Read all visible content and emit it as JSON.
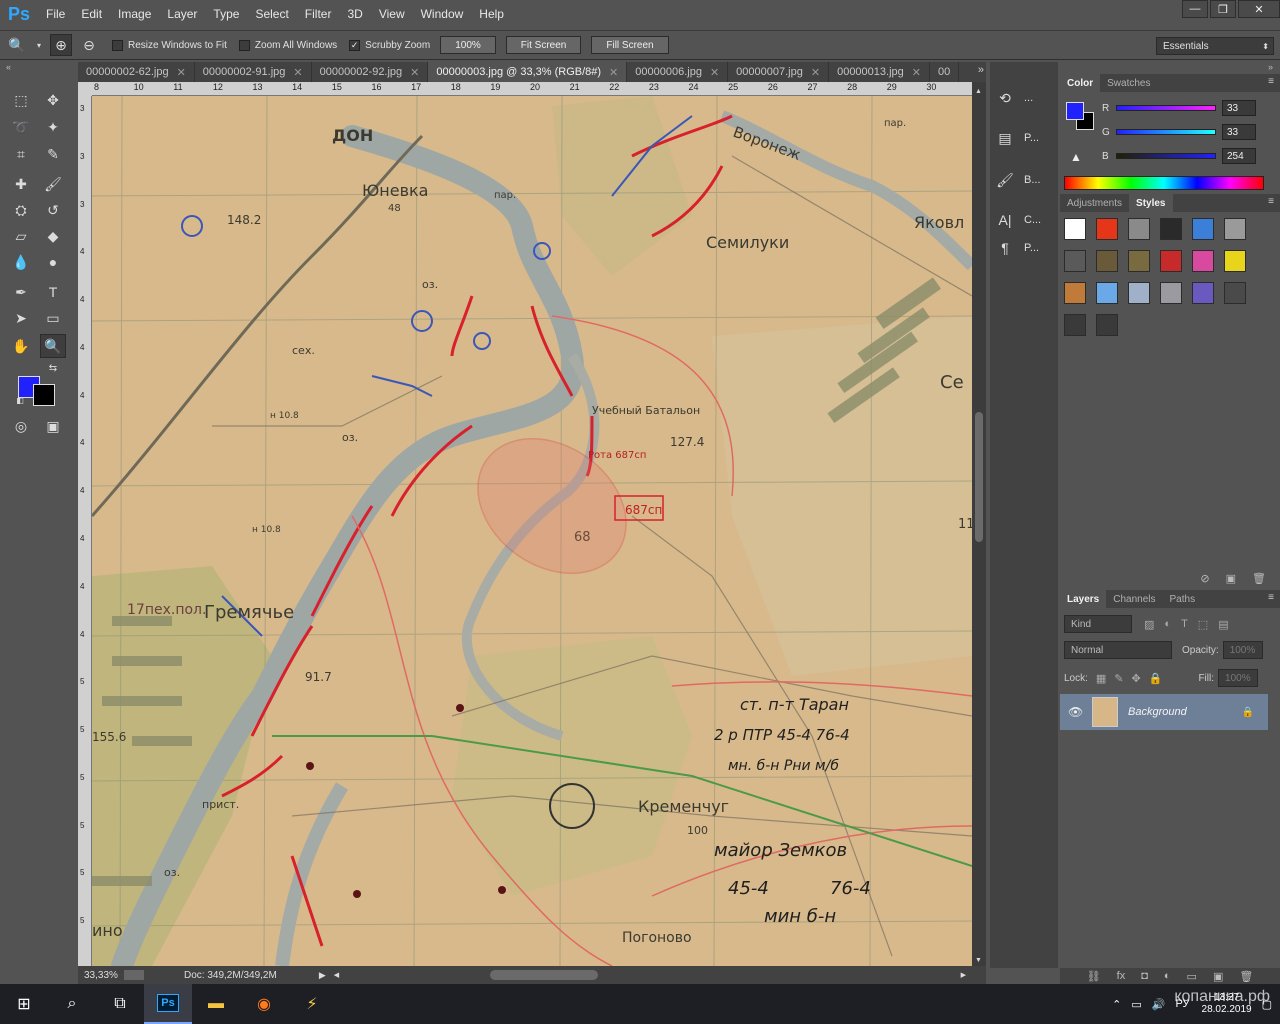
{
  "app": {
    "logo": "Ps",
    "menu": [
      "File",
      "Edit",
      "Image",
      "Layer",
      "Type",
      "Select",
      "Filter",
      "3D",
      "View",
      "Window",
      "Help"
    ],
    "window_controls": [
      "—",
      "❐",
      "✕"
    ]
  },
  "options": {
    "resize_windows": "Resize Windows to Fit",
    "zoom_all": "Zoom All Windows",
    "scrubby": "Scrubby Zoom",
    "pct": "100%",
    "fit": "Fit Screen",
    "fill": "Fill Screen",
    "workspace": "Essentials"
  },
  "tabs": [
    {
      "label": "00000002-62.jpg",
      "active": false
    },
    {
      "label": "00000002-91.jpg",
      "active": false
    },
    {
      "label": "00000002-92.jpg",
      "active": false
    },
    {
      "label": "00000003.jpg @ 33,3% (RGB/8#)",
      "active": true
    },
    {
      "label": "00000006.jpg",
      "active": false
    },
    {
      "label": "00000007.jpg",
      "active": false
    },
    {
      "label": "00000013.jpg",
      "active": false
    },
    {
      "label": "00",
      "active": false
    }
  ],
  "ruler_h": [
    "8",
    "10",
    "11",
    "12",
    "13",
    "14",
    "15",
    "16",
    "17",
    "18",
    "19",
    "20",
    "21",
    "22",
    "23",
    "24",
    "25",
    "26",
    "27",
    "28",
    "29",
    "30"
  ],
  "ruler_v": [
    "3",
    "3",
    "3",
    "4",
    "4",
    "4",
    "4",
    "4",
    "4",
    "4",
    "4",
    "4",
    "5",
    "5",
    "5",
    "5",
    "5",
    "5"
  ],
  "map": {
    "labels": [
      "ДОН",
      "Юневка",
      "48",
      "пар.",
      "Воронеж",
      "Семилуки",
      "Яковл",
      "148.2",
      "оз.",
      "сех.",
      "оз.",
      "Учебный Батальон",
      "127.4",
      "Рота 687сп",
      "687сп",
      "68",
      "Се",
      "17пех.пол.",
      "Гремячье",
      "91.7",
      "155.6",
      "ст. п-т Таран",
      "2 р ПТР 45-4 76-4",
      "мн. б-н Рни м/б",
      "Кременчуг",
      "100",
      "майор Земков",
      "45-4",
      "76-4",
      "мин б-н",
      "Погоново",
      "ино",
      "пар.",
      "прист.",
      "оз.",
      "н 10.8",
      "н 10.8",
      "11"
    ]
  },
  "status": {
    "zoom": "33,33%",
    "doc": "Doc: 349,2M/349,2M"
  },
  "dock": [
    "...",
    "P...",
    "B...",
    "C...",
    "P..."
  ],
  "color_panel": {
    "tabs": [
      "Color",
      "Swatches"
    ],
    "r_label": "R",
    "g_label": "G",
    "b_label": "B",
    "r": "33",
    "g": "33",
    "b": "254",
    "fg": "#2121fe",
    "bg": "#000000"
  },
  "styles_panel": {
    "tabs": [
      "Adjustments",
      "Styles"
    ],
    "swatch_colors": [
      "#ffffff",
      "#e5361a",
      "#8a8a8a",
      "#2a2a2a",
      "#3b7fd8",
      "#9a9a9a",
      "#5a5a5a",
      "#6a5a3a",
      "#7a6a40",
      "#c72a2a",
      "#d84aa0",
      "#e8d41a",
      "#c07a3a",
      "#6aa8e8",
      "#a0b0c8",
      "#9a9aa0",
      "#6a5ac0",
      "#4a4a4a",
      "#3a3a3a",
      "#3a3a3a"
    ]
  },
  "layers_panel": {
    "tabs": [
      "Layers",
      "Channels",
      "Paths"
    ],
    "kind": "Kind",
    "blend": "Normal",
    "opacity_label": "Opacity:",
    "opacity": "100%",
    "lock_label": "Lock:",
    "fill_label": "Fill:",
    "fill": "100%",
    "layer_name": "Background",
    "footer": [
      "⛓",
      "fx",
      "◘",
      "◐",
      "▭",
      "▣",
      "🗑"
    ]
  },
  "taskbar": {
    "tray_lang": "РУ",
    "time": "13:27",
    "date": "28.02.2019",
    "watermark": "копанина.рф"
  }
}
